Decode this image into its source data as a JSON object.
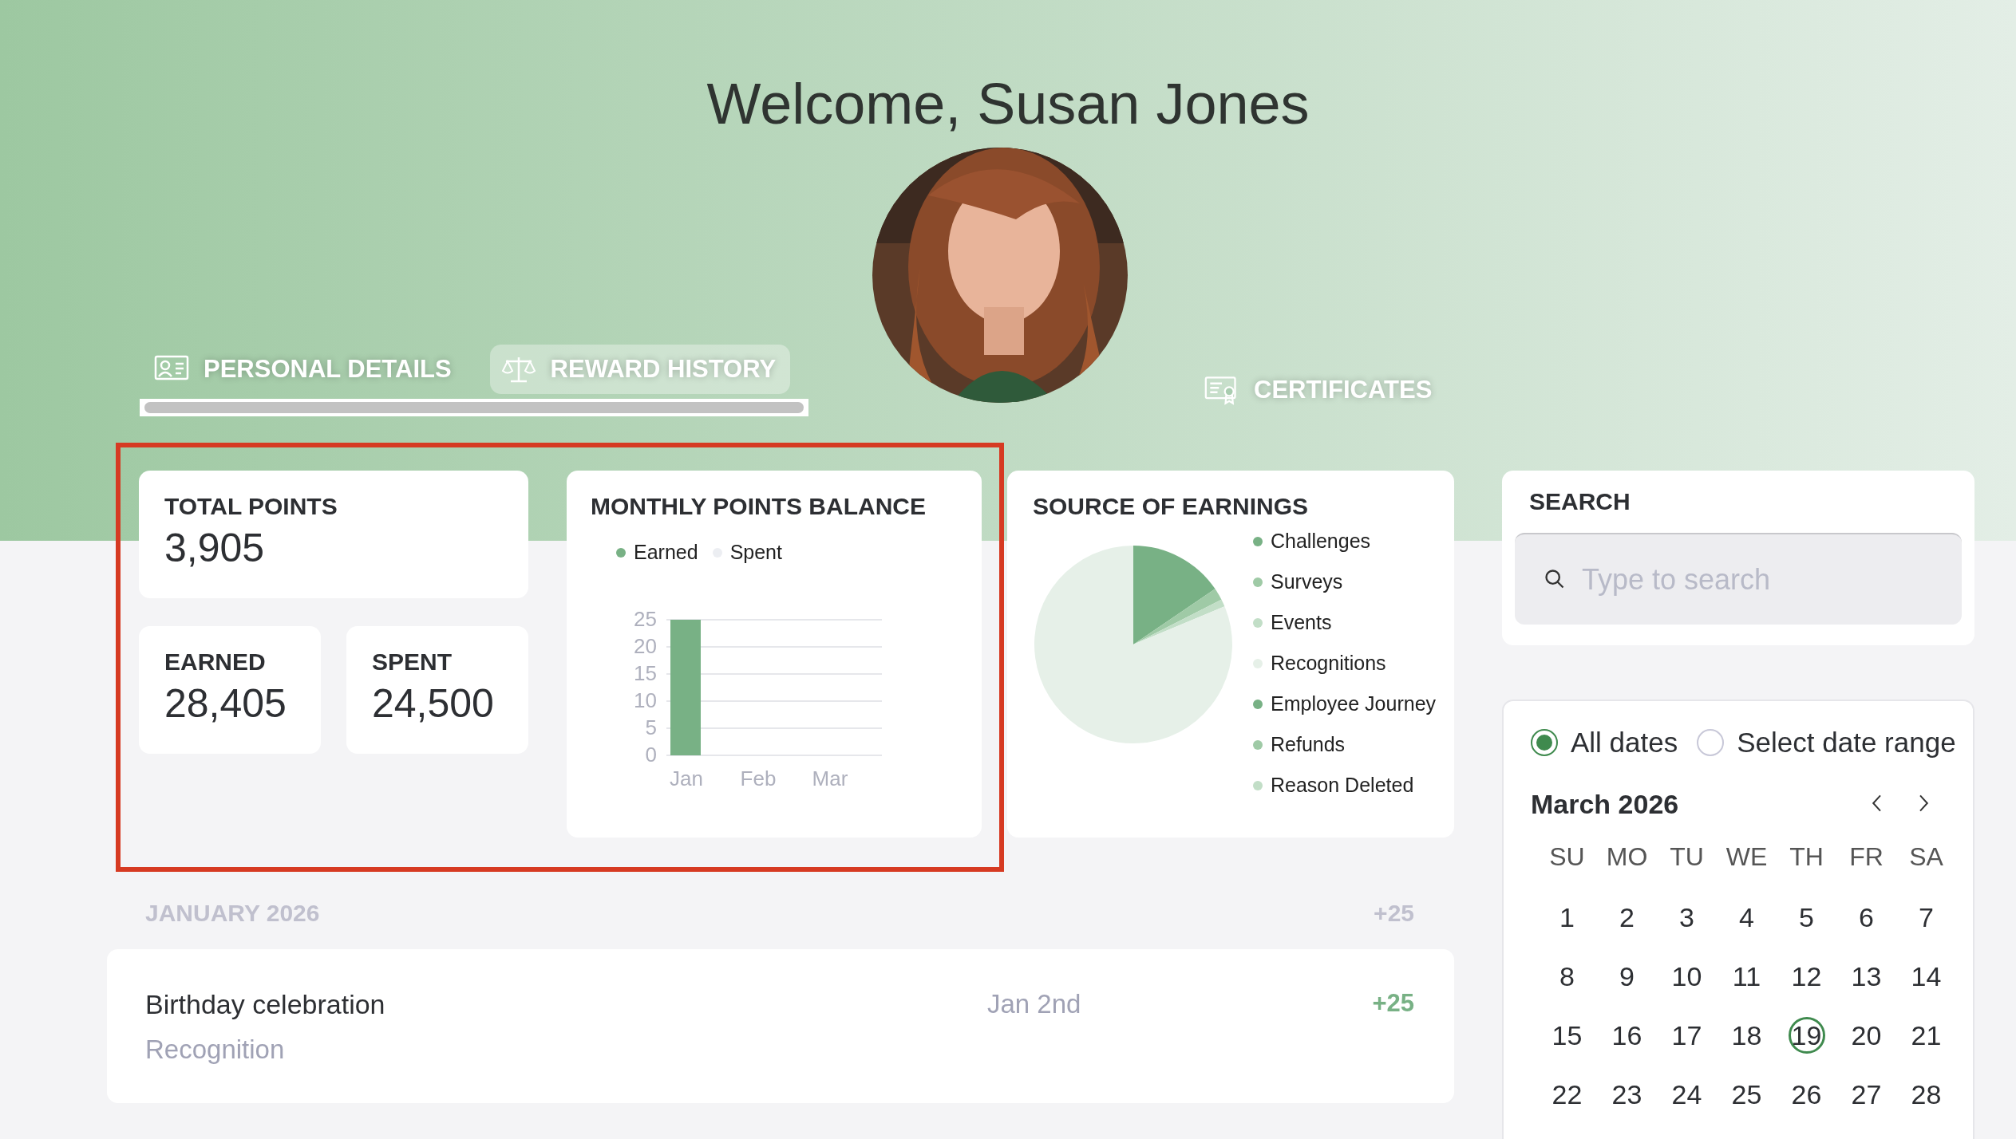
{
  "header": {
    "title": "Welcome, Susan Jones"
  },
  "tabs": [
    {
      "label": "PERSONAL DETAILS",
      "kind": "profile",
      "selected": false
    },
    {
      "label": "REWARD HISTORY",
      "kind": "rewards",
      "selected": true
    },
    {
      "label": "CERTIFICATES",
      "kind": "certificate",
      "selected": false
    }
  ],
  "summary": {
    "total": {
      "label": "TOTAL POINTS",
      "value": "3,905"
    },
    "earned": {
      "label": "EARNED",
      "value": "28,405"
    },
    "spent": {
      "label": "SPENT",
      "value": "24,500"
    }
  },
  "monthly": {
    "title": "MONTHLY POINTS BALANCE",
    "chart_data": {
      "type": "bar",
      "categories": [
        "Jan",
        "Feb",
        "Mar"
      ],
      "series": [
        {
          "name": "Earned",
          "color": "#78b185",
          "values": [
            25,
            0,
            0
          ]
        },
        {
          "name": "Spent",
          "color": "#eceef2",
          "values": [
            0,
            0,
            0
          ]
        }
      ],
      "ylim": [
        0,
        25
      ],
      "grid": true,
      "yticks": [
        0,
        5,
        10,
        15,
        20,
        25
      ]
    }
  },
  "sources": {
    "title": "SOURCE OF EARNINGS",
    "items": [
      {
        "label": "Challenges",
        "color": "#78b185"
      },
      {
        "label": "Surveys",
        "color": "#9fcaa6"
      },
      {
        "label": "Events",
        "color": "#c2dec7"
      },
      {
        "label": "Recognitions",
        "color": "#e6f0e8"
      },
      {
        "label": "Employee Journey",
        "color": "#78b185"
      },
      {
        "label": "Refunds",
        "color": "#9fcaa6"
      },
      {
        "label": "Reason Deleted",
        "color": "#c2dec7"
      }
    ]
  },
  "history": {
    "month": "JANUARY 2026",
    "total": "+25",
    "entries": [
      {
        "title": "Birthday celebration",
        "category": "Recognition",
        "date": "Jan 2nd",
        "points": "+25"
      }
    ]
  },
  "search": {
    "title": "SEARCH",
    "placeholder": "Type to search"
  },
  "date_filter": {
    "options": [
      {
        "label": "All dates",
        "selected": true
      },
      {
        "label": "Select date range",
        "selected": false
      }
    ],
    "month": "March 2026",
    "weekdays": [
      "SU",
      "MO",
      "TU",
      "WE",
      "TH",
      "FR",
      "SA"
    ],
    "weeks": [
      [
        {
          "day": "1",
          "selected": false
        },
        {
          "day": "2",
          "selected": false
        },
        {
          "day": "3",
          "selected": false
        },
        {
          "day": "4",
          "selected": false
        },
        {
          "day": "5",
          "selected": false
        },
        {
          "day": "6",
          "selected": false
        },
        {
          "day": "7",
          "selected": false
        }
      ],
      [
        {
          "day": "8",
          "selected": false
        },
        {
          "day": "9",
          "selected": false
        },
        {
          "day": "10",
          "selected": false
        },
        {
          "day": "11",
          "selected": false
        },
        {
          "day": "12",
          "selected": false
        },
        {
          "day": "13",
          "selected": false
        },
        {
          "day": "14",
          "selected": false
        }
      ],
      [
        {
          "day": "15",
          "selected": false
        },
        {
          "day": "16",
          "selected": false
        },
        {
          "day": "17",
          "selected": false
        },
        {
          "day": "18",
          "selected": false
        },
        {
          "day": "19",
          "selected": true
        },
        {
          "day": "20",
          "selected": false
        },
        {
          "day": "21",
          "selected": false
        }
      ],
      [
        {
          "day": "22",
          "selected": false
        },
        {
          "day": "23",
          "selected": false
        },
        {
          "day": "24",
          "selected": false
        },
        {
          "day": "25",
          "selected": false
        },
        {
          "day": "26",
          "selected": false
        },
        {
          "day": "27",
          "selected": false
        },
        {
          "day": "28",
          "selected": false
        }
      ]
    ]
  }
}
